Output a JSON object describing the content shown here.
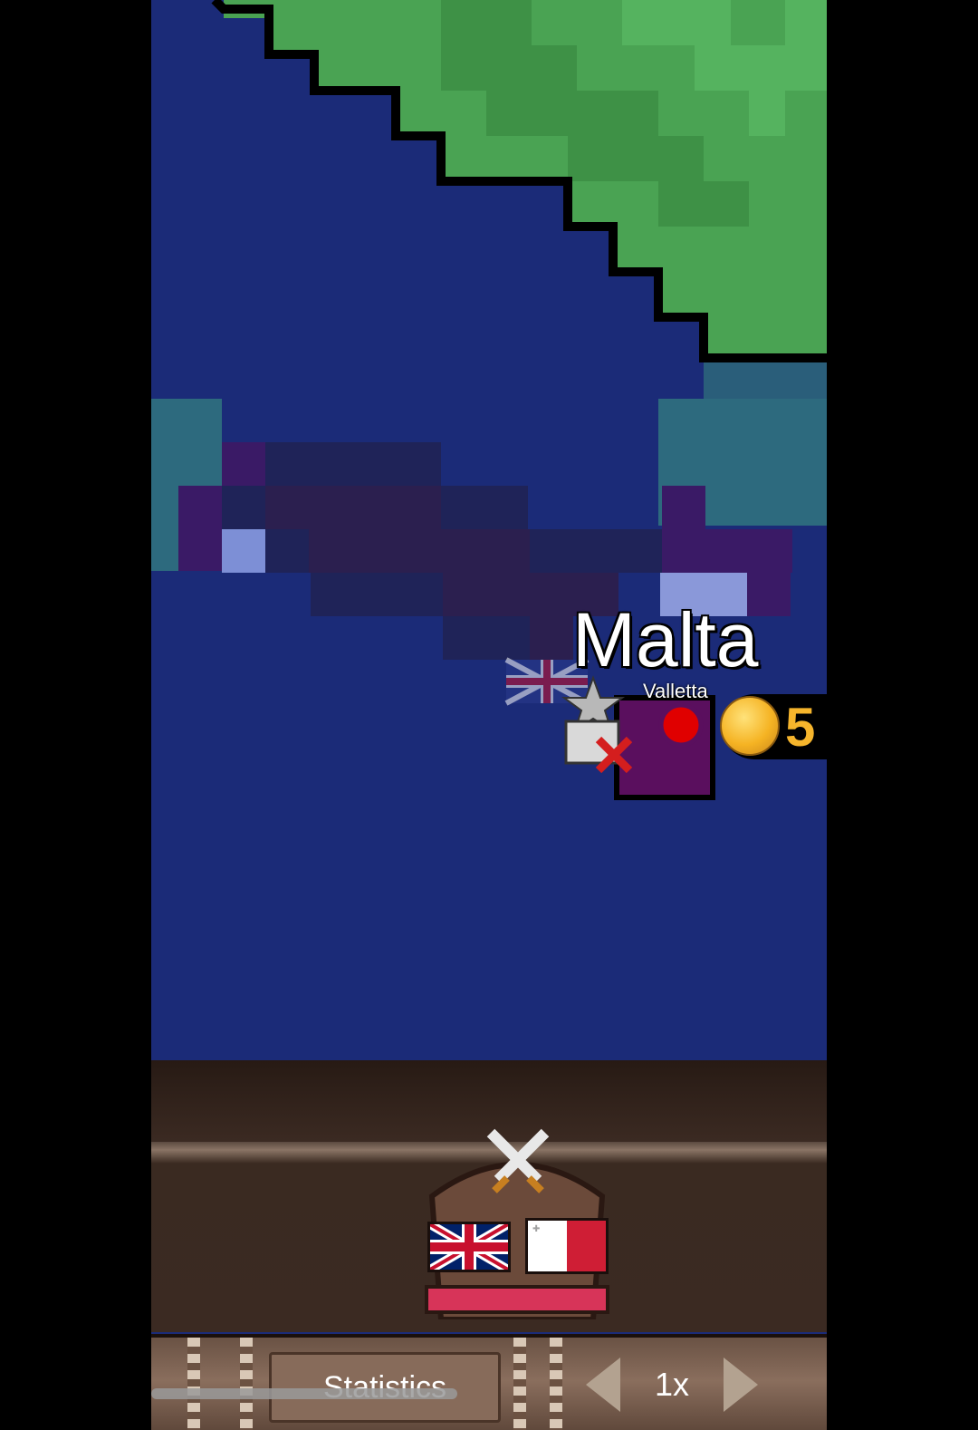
{
  "map": {
    "country_name": "Malta",
    "capital_name": "Valletta",
    "gold_count": "5",
    "colors": {
      "sea": "#1b2b78",
      "land": "#4aa353",
      "land_dark": "#3e9146",
      "shallow_teal": "#2d6a7e",
      "malta_territory": "#5a0f5e",
      "enemy_zone": "#3a1a66"
    },
    "icons": [
      "uk-flag-icon",
      "star-icon",
      "crate-icon",
      "x-mark-icon",
      "red-dot-icon",
      "gold-coin-icon"
    ]
  },
  "war_panel": {
    "icon": "crossed-swords-icon",
    "flags": [
      "uk-flag-icon",
      "malta-flag-icon"
    ]
  },
  "bottom_bar": {
    "statistics_label": "Statistics",
    "speed_label": "1x"
  }
}
